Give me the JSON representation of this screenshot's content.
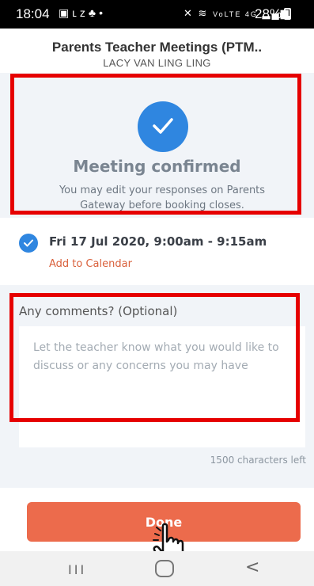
{
  "status_bar": {
    "time": "18:04",
    "left_icons": [
      "gallery-icon",
      "lz-icon",
      "notification-icon"
    ],
    "right_icons": [
      "mute-icon",
      "wifi-icon",
      "volte-icon",
      "4g-icon",
      "signal-icon"
    ],
    "right_text": "VoLTE 4G",
    "battery": "28%"
  },
  "header": {
    "title": "Parents Teacher Meetings (PTM..",
    "subtitle": "LACY VAN LING LING"
  },
  "confirmation": {
    "title": "Meeting confirmed",
    "message": "You may edit your responses on Parents Gateway before booking closes."
  },
  "meeting": {
    "datetime": "Fri 17 Jul 2020, 9:00am - 9:15am",
    "add_calendar": "Add to Calendar"
  },
  "comments": {
    "label": "Any comments? (Optional)",
    "placeholder": "Let the teacher know what you would like to discuss or any concerns you may have",
    "value": "",
    "chars_left": "1500 characters left"
  },
  "done_button": "Done",
  "nav": {
    "recent": "III",
    "back": "<"
  },
  "colors": {
    "accent_blue": "#2f86e0",
    "button_orange": "#ec6b4c",
    "panel_bg": "#f1f4f8",
    "highlight_red": "#e60000"
  }
}
